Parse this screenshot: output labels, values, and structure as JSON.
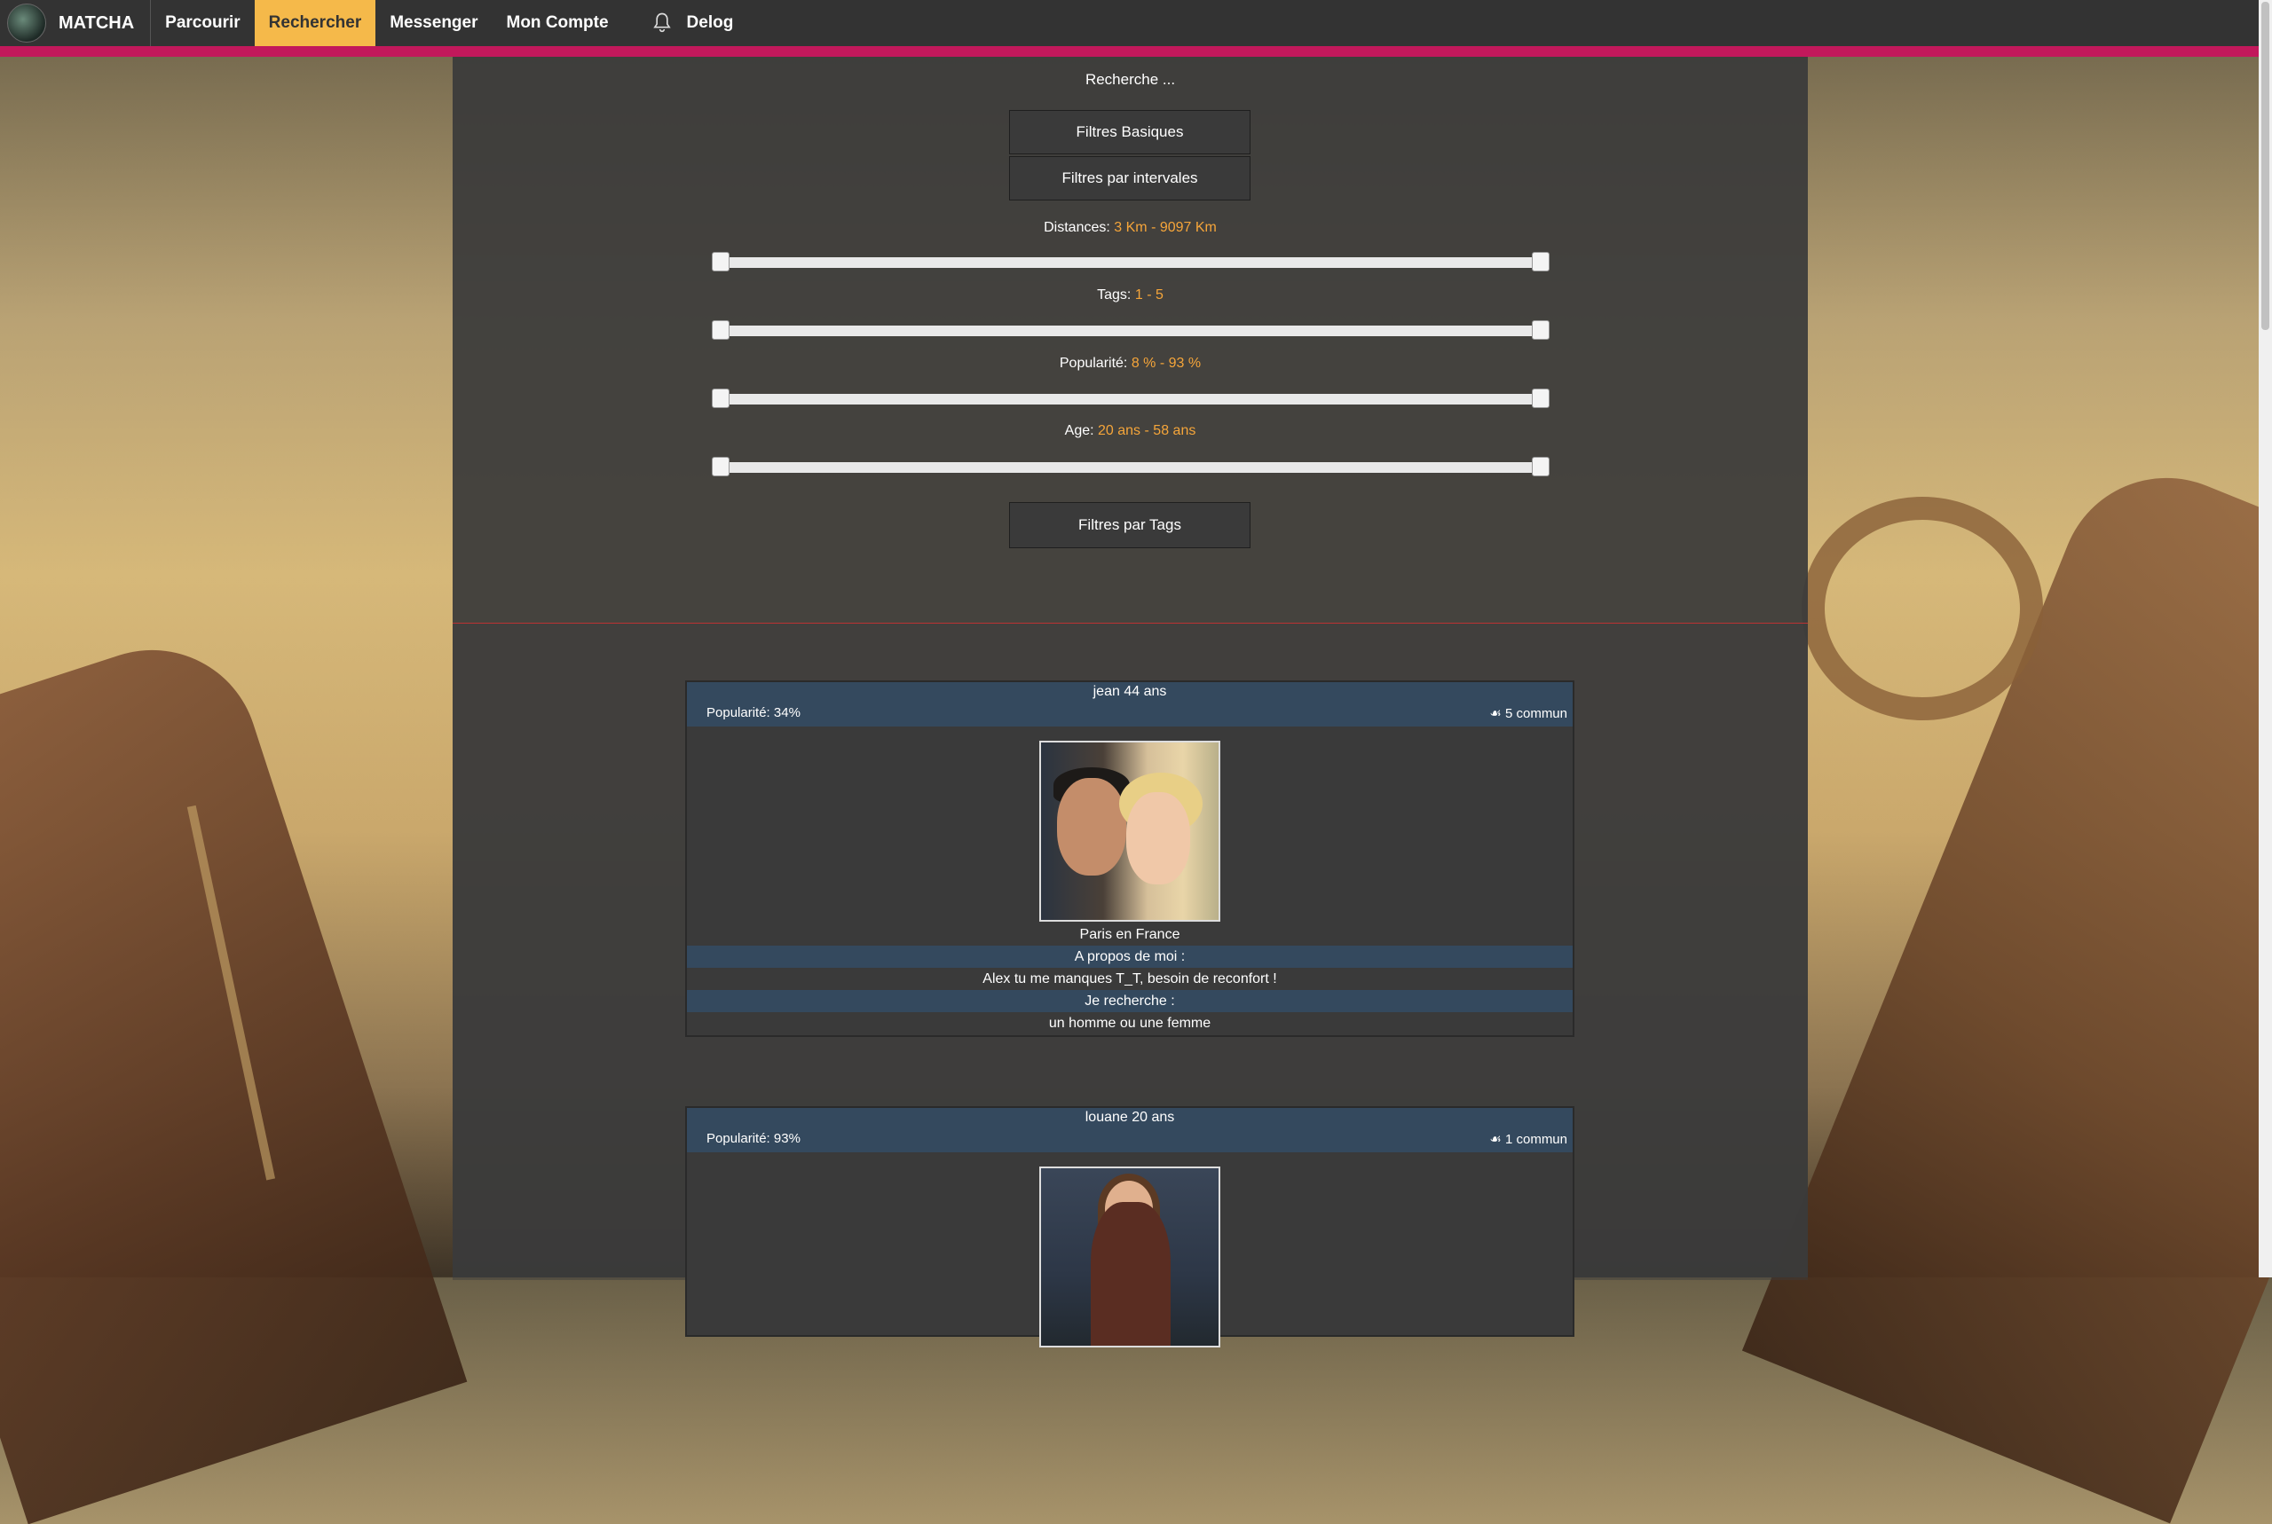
{
  "nav": {
    "brand": "MATCHA",
    "items": [
      "Parcourir",
      "Rechercher",
      "Messenger",
      "Mon Compte"
    ],
    "active": "Rechercher",
    "delog": "Delog"
  },
  "search": {
    "title": "Recherche ...",
    "basic_filters": "Filtres Basiques",
    "interval_filters": "Filtres par intervales",
    "tag_filters": "Filtres par Tags",
    "sliders": [
      {
        "label": "Distances:",
        "min": "3 Km",
        "max": "9097 Km"
      },
      {
        "label": "Tags:",
        "min": "1",
        "max": "5"
      },
      {
        "label": "Popularité:",
        "min": "8 %",
        "max": "93 %"
      },
      {
        "label": "Age:",
        "min": "20 ans",
        "max": "58 ans"
      }
    ],
    "sep": "-"
  },
  "results": [
    {
      "name": "jean 44 ans",
      "popularity": "Popularité: 34%",
      "common": "5 commun",
      "location": "Paris en France",
      "about_label": "A propos de moi :",
      "about": "Alex tu me manques T_T, besoin de reconfort !",
      "looking_label": "Je recherche :",
      "looking": "un homme ou une femme"
    },
    {
      "name": "louane 20 ans",
      "popularity": "Popularité: 93%",
      "common": "1 commun"
    }
  ],
  "colors": {
    "nav_bg": "#333333",
    "nav_accent": "#c2185b",
    "active_tab": "#f5b94a",
    "slider_value": "#f5a53a",
    "card_header": "#34495e"
  }
}
